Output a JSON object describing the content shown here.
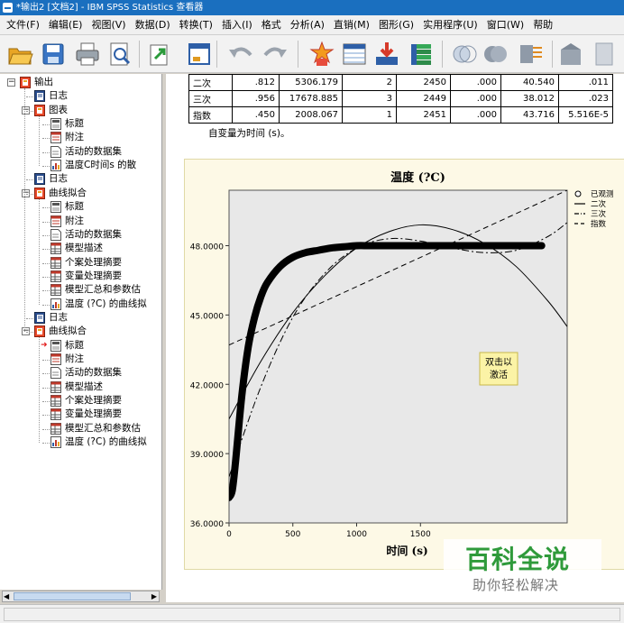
{
  "window": {
    "title": "*输出2 [文档2] - IBM SPSS Statistics 查看器"
  },
  "menu": [
    "文件(F)",
    "编辑(E)",
    "视图(V)",
    "数据(D)",
    "转换(T)",
    "插入(I)",
    "格式",
    "分析(A)",
    "直销(M)",
    "图形(G)",
    "实用程序(U)",
    "窗口(W)",
    "帮助"
  ],
  "toolbar_icons": [
    "open-folder-icon",
    "save-icon",
    "print-icon",
    "print-preview-icon",
    "export-icon",
    "recall-dialog-icon",
    "undo-icon",
    "redo-icon",
    "goto-data-icon",
    "goto-case-icon",
    "goto-variable-icon",
    "variables-icon",
    "select-cases-icon",
    "weight-cases-icon",
    "value-labels-icon",
    "use-sets-icon",
    "show-all-icon"
  ],
  "tree": [
    {
      "id": "root",
      "label": "输出",
      "depth": 0,
      "icon": "output-book",
      "expander": "−"
    },
    {
      "id": "log1",
      "label": "日志",
      "depth": 1,
      "icon": "log-book"
    },
    {
      "id": "graph",
      "label": "图表",
      "depth": 1,
      "icon": "output-book",
      "expander": "−"
    },
    {
      "id": "graph-title",
      "label": "标题",
      "depth": 2,
      "icon": "title-doc"
    },
    {
      "id": "graph-notes",
      "label": "附注",
      "depth": 2,
      "icon": "notes-doc"
    },
    {
      "id": "graph-active",
      "label": "活动的数据集",
      "depth": 2,
      "icon": "page-doc"
    },
    {
      "id": "graph-chart",
      "label": "温度C时间s 的散",
      "depth": 2,
      "icon": "chart-doc"
    },
    {
      "id": "log2",
      "label": "日志",
      "depth": 1,
      "icon": "log-book"
    },
    {
      "id": "curve1",
      "label": "曲线拟合",
      "depth": 1,
      "icon": "output-book",
      "expander": "−"
    },
    {
      "id": "c1-title",
      "label": "标题",
      "depth": 2,
      "icon": "title-doc"
    },
    {
      "id": "c1-notes",
      "label": "附注",
      "depth": 2,
      "icon": "notes-doc"
    },
    {
      "id": "c1-active",
      "label": "活动的数据集",
      "depth": 2,
      "icon": "page-doc"
    },
    {
      "id": "c1-model",
      "label": "模型描述",
      "depth": 2,
      "icon": "table-doc"
    },
    {
      "id": "c1-case",
      "label": "个案处理摘要",
      "depth": 2,
      "icon": "table-doc"
    },
    {
      "id": "c1-var",
      "label": "变量处理摘要",
      "depth": 2,
      "icon": "table-doc"
    },
    {
      "id": "c1-summary",
      "label": "模型汇总和参数估",
      "depth": 2,
      "icon": "table-doc"
    },
    {
      "id": "c1-chart",
      "label": "温度 (?C) 的曲线拟",
      "depth": 2,
      "icon": "chart-doc"
    },
    {
      "id": "log3",
      "label": "日志",
      "depth": 1,
      "icon": "log-book"
    },
    {
      "id": "curve2",
      "label": "曲线拟合",
      "depth": 1,
      "icon": "output-book",
      "expander": "−"
    },
    {
      "id": "c2-title",
      "label": "标题",
      "depth": 2,
      "icon": "title-doc",
      "current": true
    },
    {
      "id": "c2-notes",
      "label": "附注",
      "depth": 2,
      "icon": "notes-doc"
    },
    {
      "id": "c2-active",
      "label": "活动的数据集",
      "depth": 2,
      "icon": "page-doc"
    },
    {
      "id": "c2-model",
      "label": "模型描述",
      "depth": 2,
      "icon": "table-doc"
    },
    {
      "id": "c2-case",
      "label": "个案处理摘要",
      "depth": 2,
      "icon": "table-doc"
    },
    {
      "id": "c2-var",
      "label": "变量处理摘要",
      "depth": 2,
      "icon": "table-doc"
    },
    {
      "id": "c2-summary",
      "label": "模型汇总和参数估",
      "depth": 2,
      "icon": "table-doc"
    },
    {
      "id": "c2-chart",
      "label": "温度 (?C) 的曲线拟",
      "depth": 2,
      "icon": "chart-doc"
    }
  ],
  "table": {
    "rows": [
      [
        "二次",
        ".812",
        "5306.179",
        "2",
        "2450",
        ".000",
        "40.540",
        ".011"
      ],
      [
        "三次",
        ".956",
        "17678.885",
        "3",
        "2449",
        ".000",
        "38.012",
        ".023"
      ],
      [
        "指数",
        ".450",
        "2008.067",
        "1",
        "2451",
        ".000",
        "43.716",
        "5.516E-5"
      ]
    ],
    "note": "自变量为时间 (s)。"
  },
  "chart_data": {
    "type": "line",
    "title": "温度 (?C)",
    "xlabel": "时间 (s)",
    "ylabel": "",
    "xlim": [
      0,
      2650
    ],
    "ylim": [
      36,
      50.4
    ],
    "xticks": [
      "0",
      "500",
      "1000",
      "1500"
    ],
    "xtick_values": [
      0,
      500,
      1000,
      1500
    ],
    "yticks": [
      "36.0000",
      "39.0000",
      "42.0000",
      "45.0000",
      "48.0000"
    ],
    "ytick_values": [
      36,
      39,
      42,
      45,
      48
    ],
    "legend_position": "right",
    "legend": [
      {
        "name": "已观测",
        "marker": "circle"
      },
      {
        "name": "二次",
        "style": "solid"
      },
      {
        "name": "三次",
        "style": "dashdot"
      },
      {
        "name": "指数",
        "style": "dashed"
      }
    ],
    "series": [
      {
        "name": "已观测",
        "kind": "observed",
        "x": [
          0,
          25,
          50,
          100,
          150,
          200,
          250,
          300,
          400,
          500,
          600,
          700,
          800,
          900,
          1000,
          1100,
          1250,
          1500,
          2000,
          2450
        ],
        "y": [
          37.1,
          37.4,
          38.6,
          41.5,
          43.6,
          44.9,
          45.8,
          46.4,
          47.1,
          47.5,
          47.7,
          47.8,
          47.9,
          47.95,
          48.0,
          48.0,
          48.0,
          48.0,
          48.0,
          48.0
        ]
      },
      {
        "name": "二次",
        "kind": "solid",
        "x": [
          0,
          250,
          500,
          750,
          1000,
          1250,
          1500,
          1750,
          2000,
          2250,
          2500,
          2650
        ],
        "y": [
          40.5,
          43.0,
          45.1,
          46.7,
          47.9,
          48.6,
          48.9,
          48.7,
          48.1,
          47.1,
          45.6,
          44.5
        ]
      },
      {
        "name": "三次",
        "kind": "dashdot",
        "x": [
          0,
          250,
          500,
          750,
          1000,
          1250,
          1500,
          1750,
          2000,
          2250,
          2500,
          2650
        ],
        "y": [
          38.0,
          41.9,
          44.9,
          46.8,
          47.9,
          48.3,
          48.2,
          47.9,
          47.7,
          47.8,
          48.4,
          49.0
        ]
      },
      {
        "name": "指数",
        "kind": "dashed",
        "x": [
          0,
          2650
        ],
        "y": [
          43.7,
          50.4
        ]
      }
    ]
  },
  "tooltip": {
    "line1": "双击以",
    "line2": "激活"
  },
  "watermark": {
    "main": "百科全说",
    "sub": "助你轻松解决"
  }
}
